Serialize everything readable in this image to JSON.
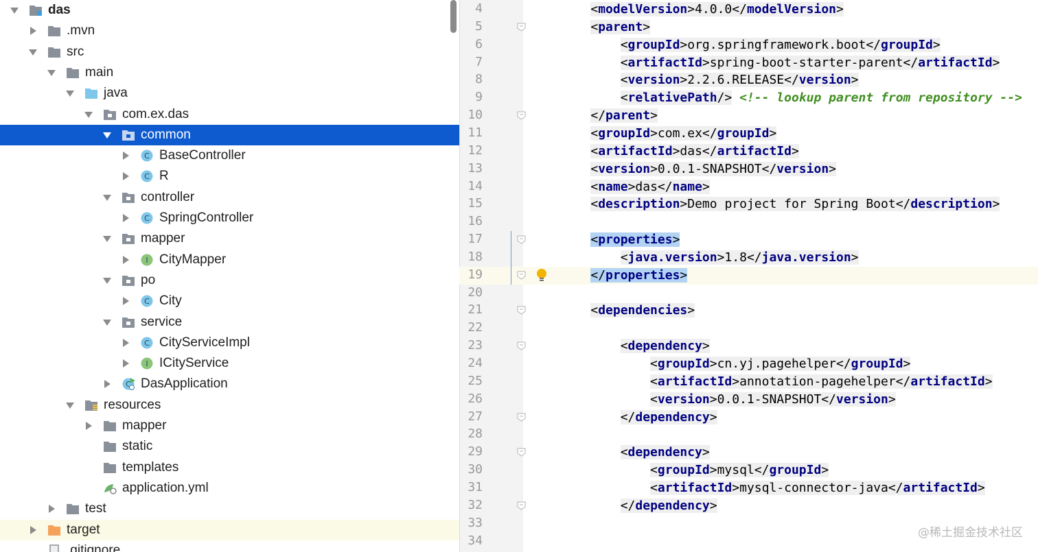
{
  "project_tree": {
    "items": [
      {
        "label": "das",
        "depth": 0,
        "arrow": "down",
        "icon": "module-folder-icon",
        "color": "#8a9099"
      },
      {
        "label": ".mvn",
        "depth": 1,
        "arrow": "right",
        "icon": "folder-icon",
        "color": "#8a9099"
      },
      {
        "label": "src",
        "depth": 1,
        "arrow": "down",
        "icon": "folder-icon",
        "color": "#8a9099"
      },
      {
        "label": "main",
        "depth": 2,
        "arrow": "down",
        "icon": "folder-icon",
        "color": "#8a9099"
      },
      {
        "label": "java",
        "depth": 3,
        "arrow": "down",
        "icon": "source-folder-icon",
        "color": "#7ec6ea"
      },
      {
        "label": "com.ex.das",
        "depth": 4,
        "arrow": "down",
        "icon": "package-icon",
        "color": "#8a9099"
      },
      {
        "label": "common",
        "depth": 5,
        "arrow": "down",
        "icon": "package-icon",
        "color": "#c7d6ef",
        "selected": true
      },
      {
        "label": "BaseController",
        "depth": 6,
        "arrow": "right",
        "icon": "class-icon",
        "color": "#7ec6ea"
      },
      {
        "label": "R",
        "depth": 6,
        "arrow": "right",
        "icon": "class-icon",
        "color": "#7ec6ea"
      },
      {
        "label": "controller",
        "depth": 5,
        "arrow": "down",
        "icon": "package-icon",
        "color": "#8a9099"
      },
      {
        "label": "SpringController",
        "depth": 6,
        "arrow": "right",
        "icon": "class-icon",
        "color": "#7ec6ea"
      },
      {
        "label": "mapper",
        "depth": 5,
        "arrow": "down",
        "icon": "package-icon",
        "color": "#8a9099"
      },
      {
        "label": "CityMapper",
        "depth": 6,
        "arrow": "right",
        "icon": "interface-icon",
        "color": "#8ac57a"
      },
      {
        "label": "po",
        "depth": 5,
        "arrow": "down",
        "icon": "package-icon",
        "color": "#8a9099"
      },
      {
        "label": "City",
        "depth": 6,
        "arrow": "right",
        "icon": "class-icon",
        "color": "#7ec6ea"
      },
      {
        "label": "service",
        "depth": 5,
        "arrow": "down",
        "icon": "package-icon",
        "color": "#8a9099"
      },
      {
        "label": "CityServiceImpl",
        "depth": 6,
        "arrow": "right",
        "icon": "class-icon",
        "color": "#7ec6ea"
      },
      {
        "label": "ICityService",
        "depth": 6,
        "arrow": "right",
        "icon": "interface-icon",
        "color": "#8ac57a"
      },
      {
        "label": "DasApplication",
        "depth": 5,
        "arrow": "right",
        "icon": "spring-boot-class-icon",
        "color": "#7ec6ea"
      },
      {
        "label": "resources",
        "depth": 3,
        "arrow": "down",
        "icon": "resources-folder-icon",
        "color": "#8a9099"
      },
      {
        "label": "mapper",
        "depth": 4,
        "arrow": "right",
        "icon": "folder-icon",
        "color": "#8a9099"
      },
      {
        "label": "static",
        "depth": 4,
        "arrow": "none",
        "icon": "folder-icon",
        "color": "#8a9099"
      },
      {
        "label": "templates",
        "depth": 4,
        "arrow": "none",
        "icon": "folder-icon",
        "color": "#8a9099"
      },
      {
        "label": "application.yml",
        "depth": 4,
        "arrow": "none",
        "icon": "yaml-file-icon",
        "color": "#6bb36b"
      },
      {
        "label": "test",
        "depth": 2,
        "arrow": "right",
        "icon": "folder-icon",
        "color": "#8a9099"
      },
      {
        "label": "target",
        "depth": 1,
        "arrow": "right",
        "icon": "excluded-folder-icon",
        "color": "#f6a15a",
        "highlighted": true
      },
      {
        "label": ".gitignore",
        "depth": 1,
        "arrow": "none",
        "icon": "file-icon",
        "color": "#8a9099"
      }
    ]
  },
  "editor": {
    "lines": [
      {
        "n": "4",
        "segs": [
          {
            "t": "    "
          },
          {
            "t": "<",
            "c": "bg"
          },
          {
            "t": "modelVersion",
            "c": "tag bg"
          },
          {
            "t": ">4.0.0</",
            "c": "bg"
          },
          {
            "t": "modelVersion",
            "c": "tag bg"
          },
          {
            "t": ">",
            "c": "bg"
          }
        ]
      },
      {
        "n": "5",
        "fold": true,
        "segs": [
          {
            "t": "    "
          },
          {
            "t": "<",
            "c": "bg"
          },
          {
            "t": "parent",
            "c": "tag bg"
          },
          {
            "t": ">",
            "c": "bg"
          }
        ]
      },
      {
        "n": "6",
        "segs": [
          {
            "t": "        "
          },
          {
            "t": "<",
            "c": "bg"
          },
          {
            "t": "groupId",
            "c": "tag bg"
          },
          {
            "t": ">org.springframework.boot</",
            "c": "bg"
          },
          {
            "t": "groupId",
            "c": "tag bg"
          },
          {
            "t": ">",
            "c": "bg"
          }
        ]
      },
      {
        "n": "7",
        "segs": [
          {
            "t": "        "
          },
          {
            "t": "<",
            "c": "bg"
          },
          {
            "t": "artifactId",
            "c": "tag bg"
          },
          {
            "t": ">spring-boot-starter-parent</",
            "c": "bg"
          },
          {
            "t": "artifactId",
            "c": "tag bg"
          },
          {
            "t": ">",
            "c": "bg"
          }
        ]
      },
      {
        "n": "8",
        "segs": [
          {
            "t": "        "
          },
          {
            "t": "<",
            "c": "bg"
          },
          {
            "t": "version",
            "c": "tag bg"
          },
          {
            "t": ">2.2.6.RELEASE</",
            "c": "bg"
          },
          {
            "t": "version",
            "c": "tag bg"
          },
          {
            "t": ">",
            "c": "bg"
          }
        ]
      },
      {
        "n": "9",
        "segs": [
          {
            "t": "        "
          },
          {
            "t": "<",
            "c": "bg"
          },
          {
            "t": "relativePath",
            "c": "tag bg"
          },
          {
            "t": "/>",
            "c": "bg"
          },
          {
            "t": " "
          },
          {
            "t": "<!-- lookup parent from repository -->",
            "c": "cmt-g"
          }
        ]
      },
      {
        "n": "10",
        "fold": true,
        "segs": [
          {
            "t": "    "
          },
          {
            "t": "</",
            "c": "bg"
          },
          {
            "t": "parent",
            "c": "tag bg"
          },
          {
            "t": ">",
            "c": "bg"
          }
        ]
      },
      {
        "n": "11",
        "segs": [
          {
            "t": "    "
          },
          {
            "t": "<",
            "c": "bg"
          },
          {
            "t": "groupId",
            "c": "tag bg"
          },
          {
            "t": ">com.ex</",
            "c": "bg"
          },
          {
            "t": "groupId",
            "c": "tag bg"
          },
          {
            "t": ">",
            "c": "bg"
          }
        ]
      },
      {
        "n": "12",
        "segs": [
          {
            "t": "    "
          },
          {
            "t": "<",
            "c": "bg"
          },
          {
            "t": "artifactId",
            "c": "tag bg"
          },
          {
            "t": ">das</",
            "c": "bg"
          },
          {
            "t": "artifactId",
            "c": "tag bg"
          },
          {
            "t": ">",
            "c": "bg"
          }
        ]
      },
      {
        "n": "13",
        "segs": [
          {
            "t": "    "
          },
          {
            "t": "<",
            "c": "bg"
          },
          {
            "t": "version",
            "c": "tag bg"
          },
          {
            "t": ">0.0.1-SNAPSHOT</",
            "c": "bg"
          },
          {
            "t": "version",
            "c": "tag bg"
          },
          {
            "t": ">",
            "c": "bg"
          }
        ]
      },
      {
        "n": "14",
        "segs": [
          {
            "t": "    "
          },
          {
            "t": "<",
            "c": "bg"
          },
          {
            "t": "name",
            "c": "tag bg"
          },
          {
            "t": ">das</",
            "c": "bg"
          },
          {
            "t": "name",
            "c": "tag bg"
          },
          {
            "t": ">",
            "c": "bg"
          }
        ]
      },
      {
        "n": "15",
        "segs": [
          {
            "t": "    "
          },
          {
            "t": "<",
            "c": "bg"
          },
          {
            "t": "description",
            "c": "tag bg"
          },
          {
            "t": ">Demo project for Spring Boot</",
            "c": "bg"
          },
          {
            "t": "description",
            "c": "tag bg"
          },
          {
            "t": ">",
            "c": "bg"
          }
        ]
      },
      {
        "n": "16",
        "segs": []
      },
      {
        "n": "17",
        "fold": true,
        "vline": true,
        "segs": [
          {
            "t": "    "
          },
          {
            "t": "<",
            "c": "hlt"
          },
          {
            "t": "properties",
            "c": "tag hlt"
          },
          {
            "t": ">",
            "c": "hlt"
          }
        ]
      },
      {
        "n": "18",
        "vline": true,
        "segs": [
          {
            "t": "        "
          },
          {
            "t": "<",
            "c": "bg"
          },
          {
            "t": "java.version",
            "c": "tag bg"
          },
          {
            "t": ">1.8</",
            "c": "bg"
          },
          {
            "t": "java.version",
            "c": "tag bg"
          },
          {
            "t": ">",
            "c": "bg"
          }
        ]
      },
      {
        "n": "19",
        "fold": true,
        "vline": true,
        "current": true,
        "bulb": true,
        "segs": [
          {
            "t": "    "
          },
          {
            "t": "</",
            "c": "hlt"
          },
          {
            "t": "properties",
            "c": "tag hlt"
          },
          {
            "t": ">",
            "c": "hlt"
          }
        ]
      },
      {
        "n": "20",
        "segs": []
      },
      {
        "n": "21",
        "fold": true,
        "segs": [
          {
            "t": "    "
          },
          {
            "t": "<",
            "c": "bg"
          },
          {
            "t": "dependencies",
            "c": "tag bg"
          },
          {
            "t": ">",
            "c": "bg"
          }
        ]
      },
      {
        "n": "22",
        "segs": []
      },
      {
        "n": "23",
        "fold": true,
        "segs": [
          {
            "t": "        "
          },
          {
            "t": "<",
            "c": "bg"
          },
          {
            "t": "dependency",
            "c": "tag bg"
          },
          {
            "t": ">",
            "c": "bg"
          }
        ]
      },
      {
        "n": "24",
        "segs": [
          {
            "t": "            "
          },
          {
            "t": "<",
            "c": "bg"
          },
          {
            "t": "groupId",
            "c": "tag bg"
          },
          {
            "t": ">cn.yj.pagehelper</",
            "c": "bg"
          },
          {
            "t": "groupId",
            "c": "tag bg"
          },
          {
            "t": ">",
            "c": "bg"
          }
        ]
      },
      {
        "n": "25",
        "segs": [
          {
            "t": "            "
          },
          {
            "t": "<",
            "c": "bg"
          },
          {
            "t": "artifactId",
            "c": "tag bg"
          },
          {
            "t": ">annotation-pagehelper</",
            "c": "bg"
          },
          {
            "t": "artifactId",
            "c": "tag bg"
          },
          {
            "t": ">",
            "c": "bg"
          }
        ]
      },
      {
        "n": "26",
        "segs": [
          {
            "t": "            "
          },
          {
            "t": "<",
            "c": "bg"
          },
          {
            "t": "version",
            "c": "tag bg"
          },
          {
            "t": ">0.0.1-SNAPSHOT</",
            "c": "bg"
          },
          {
            "t": "version",
            "c": "tag bg"
          },
          {
            "t": ">",
            "c": "bg"
          }
        ]
      },
      {
        "n": "27",
        "fold": true,
        "segs": [
          {
            "t": "        "
          },
          {
            "t": "</",
            "c": "bg"
          },
          {
            "t": "dependency",
            "c": "tag bg"
          },
          {
            "t": ">",
            "c": "bg"
          }
        ]
      },
      {
        "n": "28",
        "segs": []
      },
      {
        "n": "29",
        "fold": true,
        "segs": [
          {
            "t": "        "
          },
          {
            "t": "<",
            "c": "bg"
          },
          {
            "t": "dependency",
            "c": "tag bg"
          },
          {
            "t": ">",
            "c": "bg"
          }
        ]
      },
      {
        "n": "30",
        "segs": [
          {
            "t": "            "
          },
          {
            "t": "<",
            "c": "bg"
          },
          {
            "t": "groupId",
            "c": "tag bg"
          },
          {
            "t": ">mysql</",
            "c": "bg"
          },
          {
            "t": "groupId",
            "c": "tag bg"
          },
          {
            "t": ">",
            "c": "bg"
          }
        ]
      },
      {
        "n": "31",
        "segs": [
          {
            "t": "            "
          },
          {
            "t": "<",
            "c": "bg"
          },
          {
            "t": "artifactId",
            "c": "tag bg"
          },
          {
            "t": ">mysql-connector-java</",
            "c": "bg"
          },
          {
            "t": "artifactId",
            "c": "tag bg"
          },
          {
            "t": ">",
            "c": "bg"
          }
        ]
      },
      {
        "n": "32",
        "fold": true,
        "segs": [
          {
            "t": "        "
          },
          {
            "t": "</",
            "c": "bg"
          },
          {
            "t": "dependency",
            "c": "tag bg"
          },
          {
            "t": ">",
            "c": "bg"
          }
        ]
      },
      {
        "n": "33",
        "segs": []
      },
      {
        "n": "34",
        "segs": []
      }
    ]
  },
  "watermark": "@稀土掘金技术社区"
}
